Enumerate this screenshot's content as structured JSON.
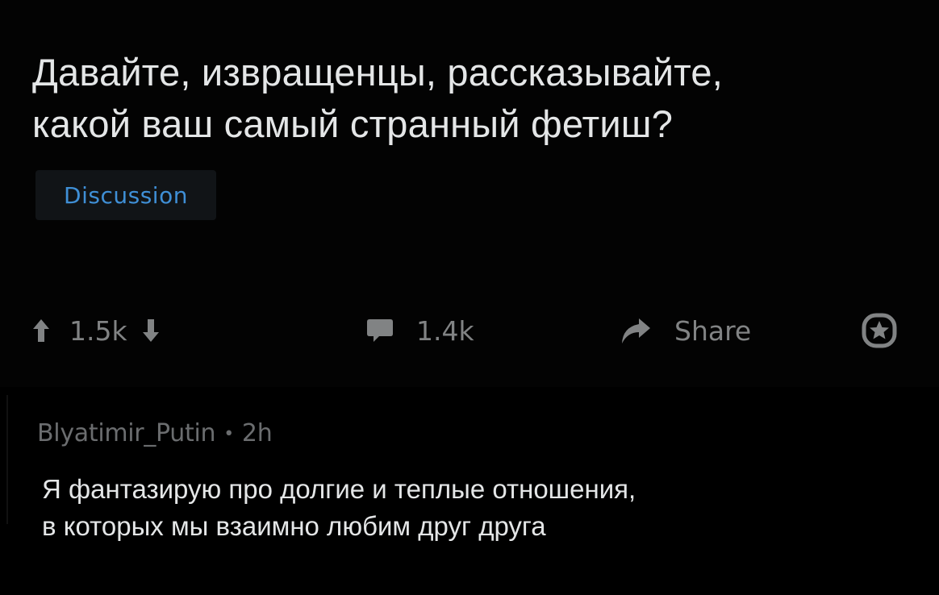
{
  "post": {
    "title_line1": "Давайте, извращенцы, рассказывайте,",
    "title_line2": "какой ваш самый странный фетиш?",
    "flair": "Discussion",
    "votes": "1.5k",
    "comments": "1.4k",
    "share_label": "Share"
  },
  "comment": {
    "author": "Blyatimir_Putin",
    "separator": "•",
    "age": "2h",
    "body_line1": "Я фантазирую про долгие и теплые отношения,",
    "body_line2": "в которых мы взаимно любим друг друга"
  },
  "icons": {
    "upvote": "arrow-up-icon",
    "downvote": "arrow-down-icon",
    "comments": "speech-bubble-icon",
    "share": "share-arrow-icon",
    "award": "award-icon"
  },
  "colors": {
    "background": "#000000",
    "title_text": "#e4e6e7",
    "flair_text": "#3f8fd6",
    "flair_bg": "#111417",
    "muted": "#818384"
  }
}
